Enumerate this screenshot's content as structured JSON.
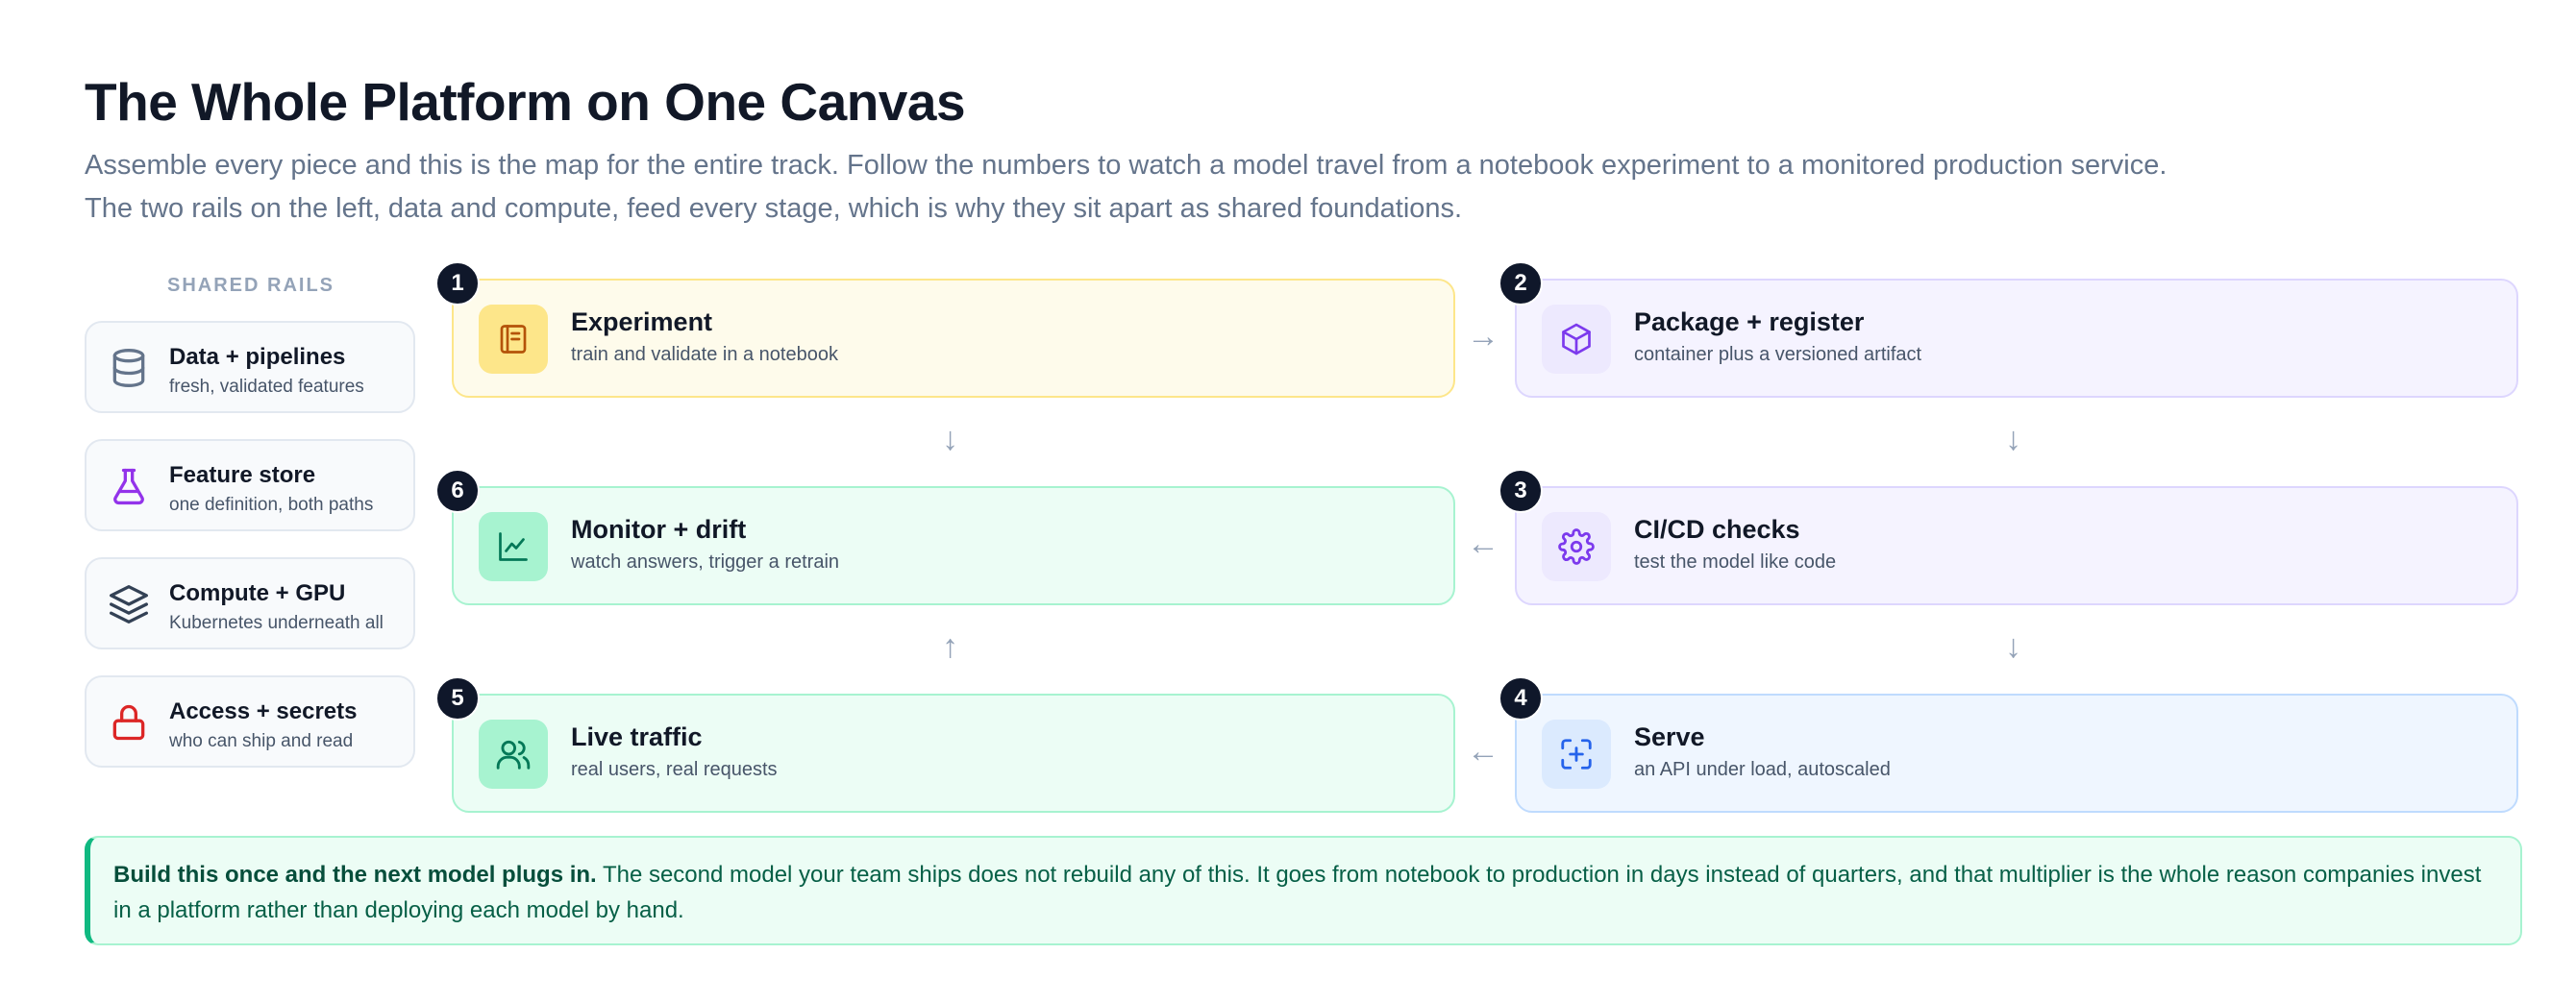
{
  "page": {
    "title": "The Whole Platform on One Canvas",
    "subtitle_line1": "Assemble every piece and this is the map for the entire track. Follow the numbers to watch a model travel from a notebook experiment to a monitored production service.",
    "subtitle_line2": "The two rails on the left, data and compute, feed every stage, which is why they sit apart as shared foundations."
  },
  "rails": {
    "label": "SHARED RAILS",
    "items": [
      {
        "title": "Data + pipelines",
        "subtitle": "fresh, validated features",
        "icon": "database-icon"
      },
      {
        "title": "Feature store",
        "subtitle": "one definition, both paths",
        "icon": "flask-icon"
      },
      {
        "title": "Compute + GPU",
        "subtitle": "Kubernetes underneath all",
        "icon": "layers-icon"
      },
      {
        "title": "Access + secrets",
        "subtitle": "who can ship and read",
        "icon": "lock-icon"
      }
    ]
  },
  "stages": [
    {
      "number": "1",
      "title": "Experiment",
      "subtitle": "train and validate in a notebook",
      "icon": "notebook-icon",
      "color": "#d97706"
    },
    {
      "number": "2",
      "title": "Package + register",
      "subtitle": "container plus a versioned artifact",
      "icon": "box-icon",
      "color": "#7c3aed"
    },
    {
      "number": "3",
      "title": "CI/CD checks",
      "subtitle": "test the model like code",
      "icon": "gear-icon",
      "color": "#7c3aed"
    },
    {
      "number": "4",
      "title": "Serve",
      "subtitle": "an API under load, autoscaled",
      "icon": "scan-plus-icon",
      "color": "#2563eb"
    },
    {
      "number": "5",
      "title": "Live traffic",
      "subtitle": "real users, real requests",
      "icon": "users-icon",
      "color": "#059669"
    },
    {
      "number": "6",
      "title": "Monitor + drift",
      "subtitle": "watch answers, trigger a retrain",
      "icon": "line-chart-icon",
      "color": "#059669"
    }
  ],
  "arrows": {
    "right": "→",
    "left": "←",
    "down": "↓",
    "up": "↑"
  },
  "callout": {
    "bold": "Build this once and the next model plugs in.",
    "text": " The second model your team ships does not rebuild any of this. It goes from notebook to production in days instead of quarters, and that multiplier is the whole reason companies invest in a platform rather than deploying each model by hand."
  },
  "colors": {
    "rail_db": "#64748b",
    "rail_flask": "#9333ea",
    "rail_layers": "#334155",
    "rail_lock": "#dc2626"
  }
}
